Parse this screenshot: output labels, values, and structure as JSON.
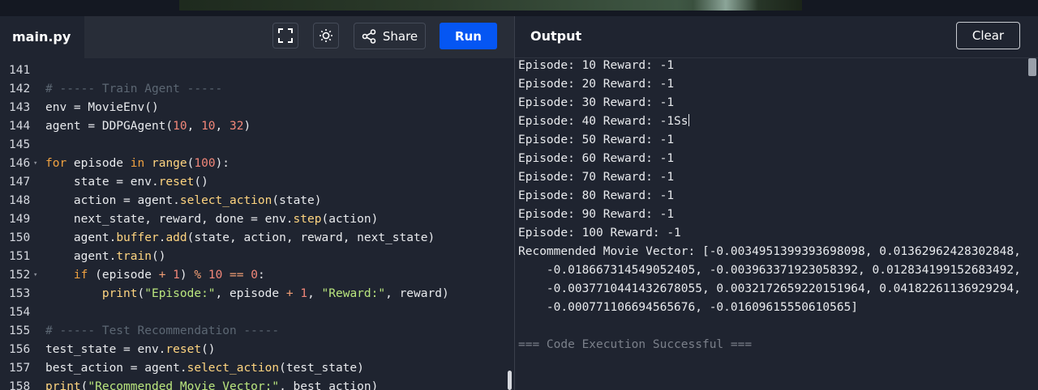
{
  "editor": {
    "filename": "main.py",
    "share_label": "Share",
    "run_label": "Run",
    "icons": [
      "fullscreen-icon",
      "theme-icon",
      "share-icon",
      "fold-arrow-icon"
    ],
    "lines": [
      {
        "n": "141",
        "t": ""
      },
      {
        "n": "142",
        "t": "# ----- Train Agent -----"
      },
      {
        "n": "143",
        "t": "env = MovieEnv()"
      },
      {
        "n": "144",
        "t": "agent = DDPGAgent(10, 10, 32)"
      },
      {
        "n": "145",
        "t": ""
      },
      {
        "n": "146",
        "t": "for episode in range(100):"
      },
      {
        "n": "147",
        "t": "    state = env.reset()"
      },
      {
        "n": "148",
        "t": "    action = agent.select_action(state)"
      },
      {
        "n": "149",
        "t": "    next_state, reward, done = env.step(action)"
      },
      {
        "n": "150",
        "t": "    agent.buffer.add(state, action, reward, next_state)"
      },
      {
        "n": "151",
        "t": "    agent.train()"
      },
      {
        "n": "152",
        "t": "    if (episode + 1) % 10 == 0:"
      },
      {
        "n": "153",
        "t": "        print(\"Episode:\", episode + 1, \"Reward:\", reward)"
      },
      {
        "n": "154",
        "t": ""
      },
      {
        "n": "155",
        "t": "# ----- Test Recommendation -----"
      },
      {
        "n": "156",
        "t": "test_state = env.reset()"
      },
      {
        "n": "157",
        "t": "best_action = agent.select_action(test_state)"
      },
      {
        "n": "158",
        "t": "print(\"Recommended Movie Vector:\", best_action)"
      }
    ]
  },
  "output": {
    "title": "Output",
    "clear_label": "Clear",
    "lines": [
      "Episode: 10 Reward: -1",
      "Episode: 20 Reward: -1",
      "Episode: 30 Reward: -1",
      "Episode: 40 Reward: -1Ss",
      "Episode: 50 Reward: -1",
      "Episode: 60 Reward: -1",
      "Episode: 70 Reward: -1",
      "Episode: 80 Reward: -1",
      "Episode: 90 Reward: -1",
      "Episode: 100 Reward: -1",
      "Recommended Movie Vector: [-0.0034951399393698098, 0.01362962428302848,",
      "    -0.018667314549052405, -0.003963371923058392, 0.012834199152683492,",
      "    -0.0037710441432678055, 0.0032172659220151964, 0.04182261136929294,",
      "    -0.000771106694565676, -0.01609615550610565]",
      "",
      "=== Code Execution Successful ==="
    ]
  }
}
